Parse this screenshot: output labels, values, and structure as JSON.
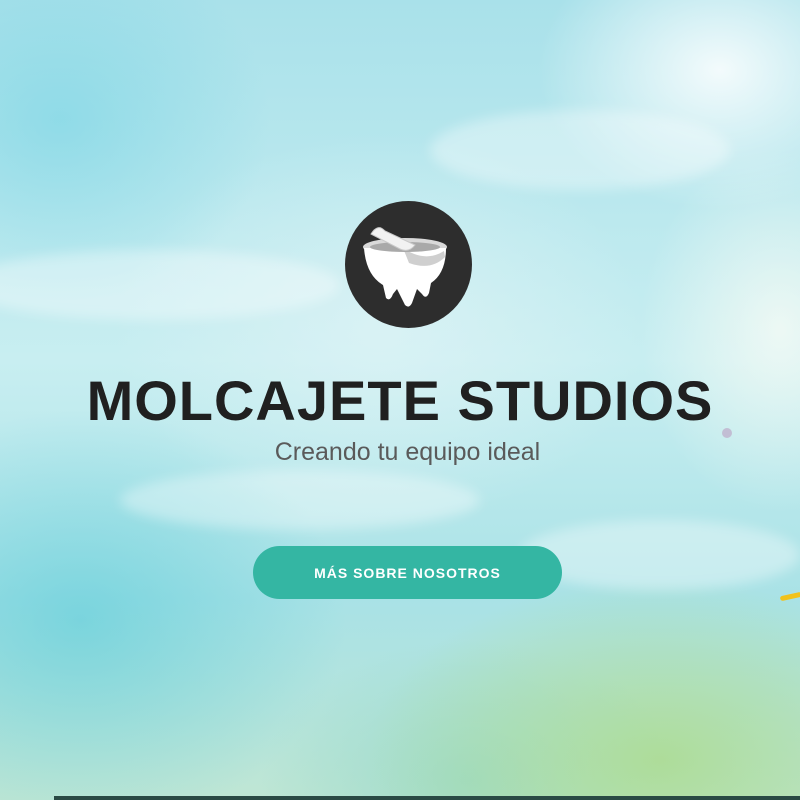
{
  "hero": {
    "title": "MOLCAJETE STUDIOS",
    "subtitle": "Creando tu equipo ideal",
    "cta_label": "MÁS SOBRE NOSOTROS",
    "logo_icon": "molcajete-icon"
  },
  "colors": {
    "accent": "#34b6a3",
    "title": "#202020",
    "subtitle": "#5a5a5a",
    "logo_background": "#2d2d2d"
  }
}
